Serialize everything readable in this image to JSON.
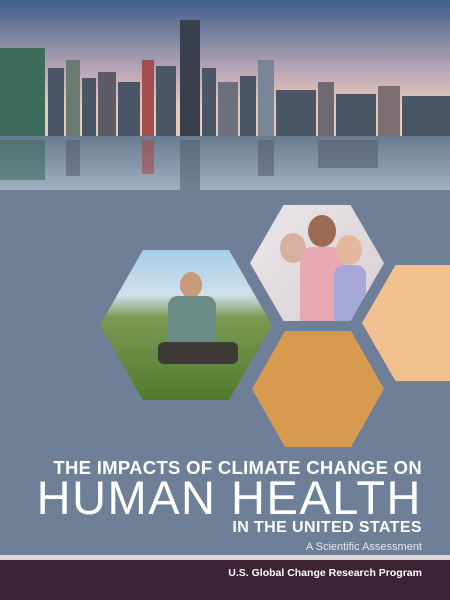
{
  "cover": {
    "title_line1": "THE IMPACTS OF CLIMATE CHANGE ON",
    "title_line2": "HUMAN HEALTH",
    "title_line3": "IN THE UNITED STATES",
    "subtitle": "A Scientific Assessment",
    "publisher": "U.S. Global Change Research Program"
  },
  "colors": {
    "background": "#6f7f98",
    "footer": "#3c2233",
    "hex_orange": "#d89a4f",
    "hex_peach": "#f0c08e"
  },
  "images": [
    "city-skyline-photo",
    "man-in-field-photo",
    "doctor-with-child-photo"
  ]
}
